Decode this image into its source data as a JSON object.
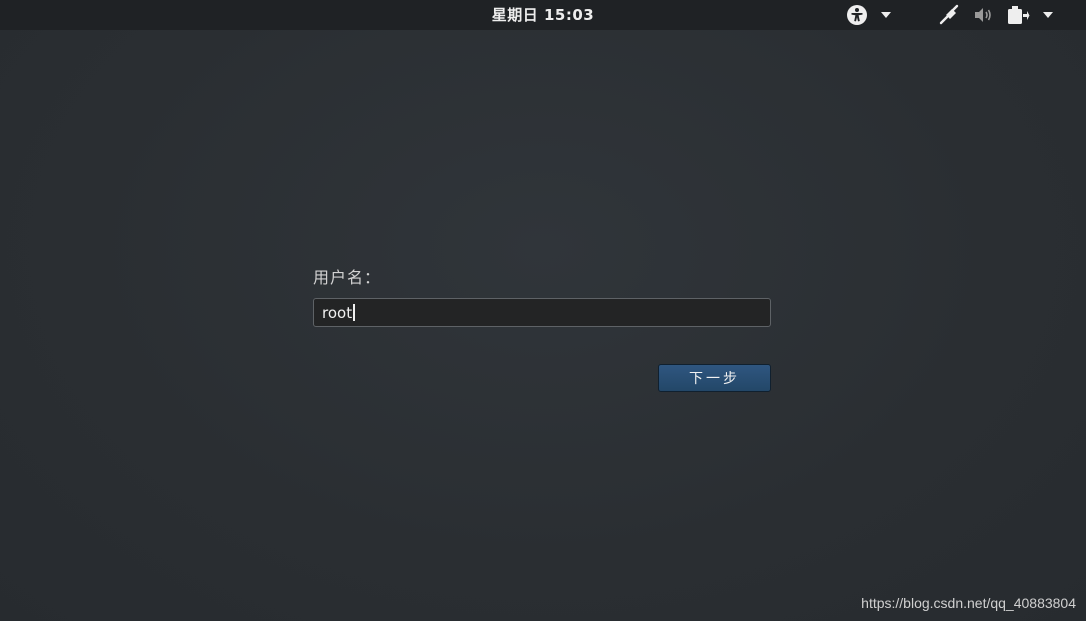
{
  "topbar": {
    "clock": "星期日 15:03",
    "icons": [
      "accessibility-icon",
      "chevron-down-icon",
      "network-icon",
      "volume-icon",
      "battery-icon",
      "chevron-down-icon"
    ]
  },
  "login": {
    "username_label": "用户名：",
    "username_value": "root",
    "next_button_label": "下一步"
  },
  "watermark": "https://blog.csdn.net/qq_40883804",
  "colors": {
    "background": "#2b2f33",
    "button": "#2b4f76",
    "input_bg": "#232425"
  }
}
